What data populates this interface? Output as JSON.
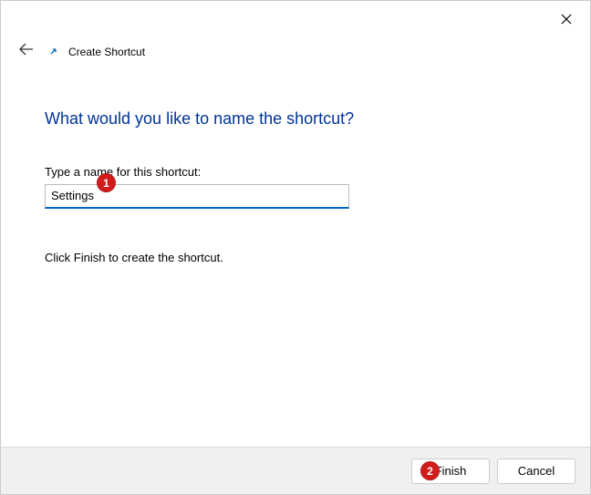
{
  "header": {
    "title": "Create Shortcut"
  },
  "content": {
    "heading": "What would you like to name the shortcut?",
    "inputLabel": "Type a name for this shortcut:",
    "inputValue": "Settings",
    "helpText": "Click Finish to create the shortcut."
  },
  "footer": {
    "finishLabel": "Finish",
    "cancelLabel": "Cancel"
  },
  "annotations": {
    "badge1": "1",
    "badge2": "2"
  }
}
